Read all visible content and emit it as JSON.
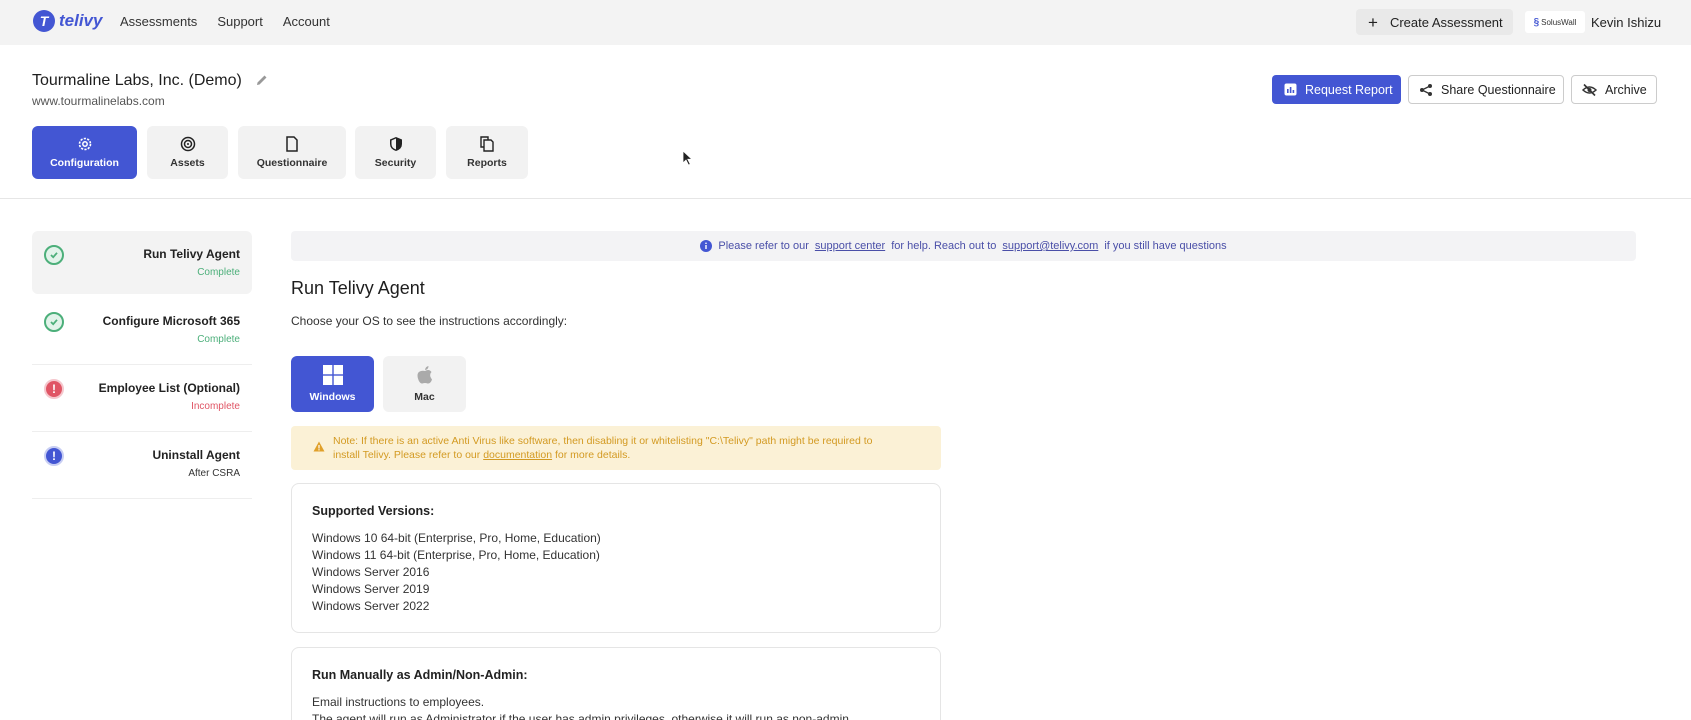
{
  "brand": {
    "name": "telivy",
    "mark": "T",
    "color": "#4356d3"
  },
  "nav": {
    "items": [
      "Assessments",
      "Support",
      "Account"
    ]
  },
  "topbar": {
    "create_label": "Create Assessment",
    "org_logo_text": "SolusWall",
    "user_name": "Kevin Ishizu"
  },
  "header": {
    "company": "Tourmaline Labs, Inc. (Demo)",
    "website": "www.tourmalinelabs.com",
    "request_report": "Request Report",
    "share": "Share Questionnaire",
    "archive": "Archive"
  },
  "tabs": [
    {
      "label": "Configuration",
      "icon": "gear-icon",
      "active": true
    },
    {
      "label": "Assets",
      "icon": "target-icon",
      "active": false
    },
    {
      "label": "Questionnaire",
      "icon": "document-icon",
      "active": false
    },
    {
      "label": "Security",
      "icon": "shield-icon",
      "active": false
    },
    {
      "label": "Reports",
      "icon": "copy-document-icon",
      "active": false
    }
  ],
  "steps": [
    {
      "title": "Run Telivy Agent",
      "status": "Complete",
      "state": "complete",
      "status_color": "#4caf7a"
    },
    {
      "title": "Configure Microsoft 365",
      "status": "Complete",
      "state": "complete",
      "status_color": "#4caf7a"
    },
    {
      "title": "Employee List (Optional)",
      "status": "Incomplete",
      "state": "error",
      "status_color": "#e05565"
    },
    {
      "title": "Uninstall Agent",
      "status": "After CSRA",
      "state": "info",
      "status_color": "#333333"
    }
  ],
  "info": {
    "prefix": "Please refer to our",
    "link1": "support center",
    "middle": "for help. Reach out to",
    "link2": "support@telivy.com",
    "suffix": "if you still have questions"
  },
  "main": {
    "title": "Run Telivy Agent",
    "subtitle": "Choose your OS to see the instructions accordingly:",
    "os": [
      {
        "label": "Windows",
        "active": true
      },
      {
        "label": "Mac",
        "active": false
      }
    ],
    "note": {
      "text1": "Note: If there is an active Anti Virus like software, then disabling it or whitelisting \"C:\\Telivy\" path might be required to",
      "text2": "install Telivy. Please refer to our",
      "link": "documentation",
      "text3": "for more details."
    },
    "supported": {
      "title": "Supported Versions:",
      "versions": [
        "Windows 10 64-bit (Enterprise, Pro, Home, Education)",
        "Windows 11 64-bit (Enterprise, Pro, Home, Education)",
        "Windows Server 2016",
        "Windows Server 2019",
        "Windows Server 2022"
      ]
    },
    "manual": {
      "title": "Run Manually as Admin/Non-Admin:",
      "lines": [
        "Email instructions to employees.",
        "The agent will run as Administrator if the user has admin privileges, otherwise it will run as non-admin."
      ]
    }
  }
}
